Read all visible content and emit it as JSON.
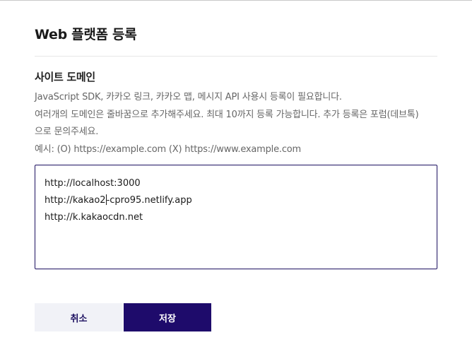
{
  "dialog": {
    "title": "Web 플랫폼 등록"
  },
  "site_domain": {
    "heading": "사이트 도메인",
    "descriptions": [
      "JavaScript SDK, 카카오 링크, 카카오 맵, 메시지 API 사용시 등록이 필요합니다.",
      "여러개의 도메인은 줄바꿈으로 추가해주세요. 최대 10까지 등록 가능합니다. 추가 등록은 포럼(데브톡)",
      "으로 문의주세요.",
      "예시: (O) https://example.com (X) https://www.example.com"
    ],
    "domains": [
      "http://localhost:3000",
      "http://kakao2-cpro95.netlify.app",
      "http://k.kakaocdn.net"
    ],
    "caret_line_prefix": "http://kakao2",
    "caret_line_suffix": "-cpro95.netlify.app"
  },
  "actions": {
    "cancel_label": "취소",
    "save_label": "저장"
  },
  "colors": {
    "primary": "#1e0b6b",
    "cancel_bg": "#f1f2f7",
    "input_border": "#1c1060"
  }
}
